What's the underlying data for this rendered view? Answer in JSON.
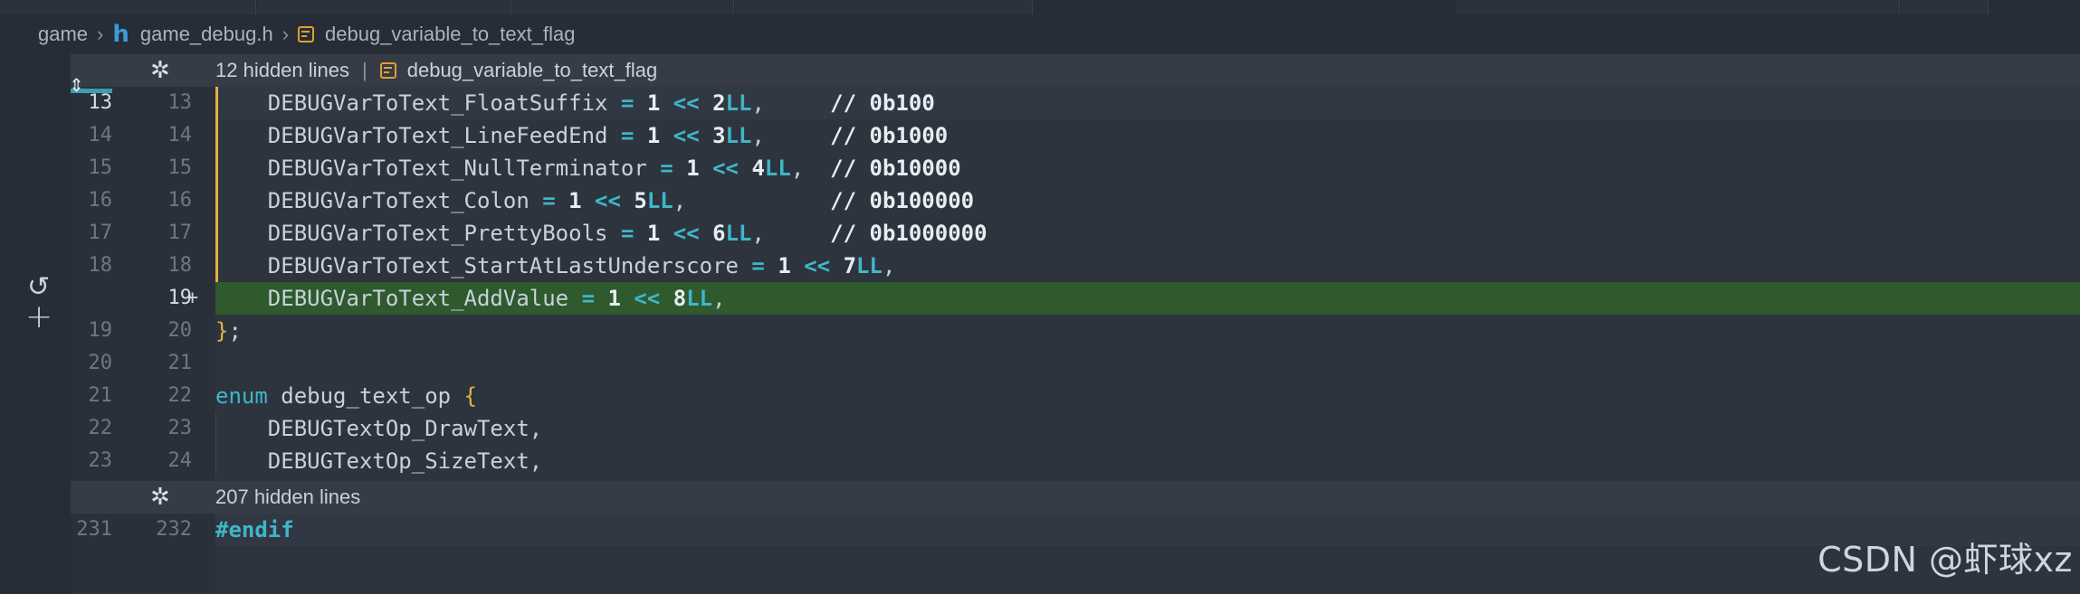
{
  "breadcrumb": {
    "folder": "game",
    "file": "game_debug.h",
    "file_icon": "h",
    "symbol": "debug_variable_to_text_flag"
  },
  "fold_top": {
    "label": "12 hidden lines",
    "separator": "|",
    "symbol": "debug_variable_to_text_flag"
  },
  "fold_bottom": {
    "label": "207 hidden lines"
  },
  "lines": [
    {
      "old": "13",
      "new": "13",
      "text": "    DEBUGVarToText_FloatSuffix = 1 << 2LL,     // 0b100"
    },
    {
      "old": "14",
      "new": "14",
      "text": "    DEBUGVarToText_LineFeedEnd = 1 << 3LL,     // 0b1000"
    },
    {
      "old": "15",
      "new": "15",
      "text": "    DEBUGVarToText_NullTerminator = 1 << 4LL,  // 0b10000"
    },
    {
      "old": "16",
      "new": "16",
      "text": "    DEBUGVarToText_Colon = 1 << 5LL,           // 0b100000"
    },
    {
      "old": "17",
      "new": "17",
      "text": "    DEBUGVarToText_PrettyBools = 1 << 6LL,     // 0b1000000"
    },
    {
      "old": "18",
      "new": "18",
      "text": "    DEBUGVarToText_StartAtLastUnderscore = 1 << 7LL,"
    },
    {
      "old": "",
      "new": "19",
      "marker": "+",
      "text": "    DEBUGVarToText_AddValue = 1 << 8LL,"
    },
    {
      "old": "19",
      "new": "20",
      "text": "};"
    },
    {
      "old": "20",
      "new": "21",
      "text": ""
    },
    {
      "old": "21",
      "new": "22",
      "text": "enum debug_text_op {"
    },
    {
      "old": "22",
      "new": "23",
      "text": "    DEBUGTextOp_DrawText,"
    },
    {
      "old": "23",
      "new": "24",
      "text": "    DEBUGTextOp_SizeText,"
    }
  ],
  "last_line": {
    "old": "231",
    "new": "232",
    "text": "#endif"
  },
  "watermark": "CSDN @虾球xz",
  "colors": {
    "added_bg": "#2e5a2e",
    "modified_bar": "#e3b341",
    "keyword": "#3fb6c9"
  }
}
